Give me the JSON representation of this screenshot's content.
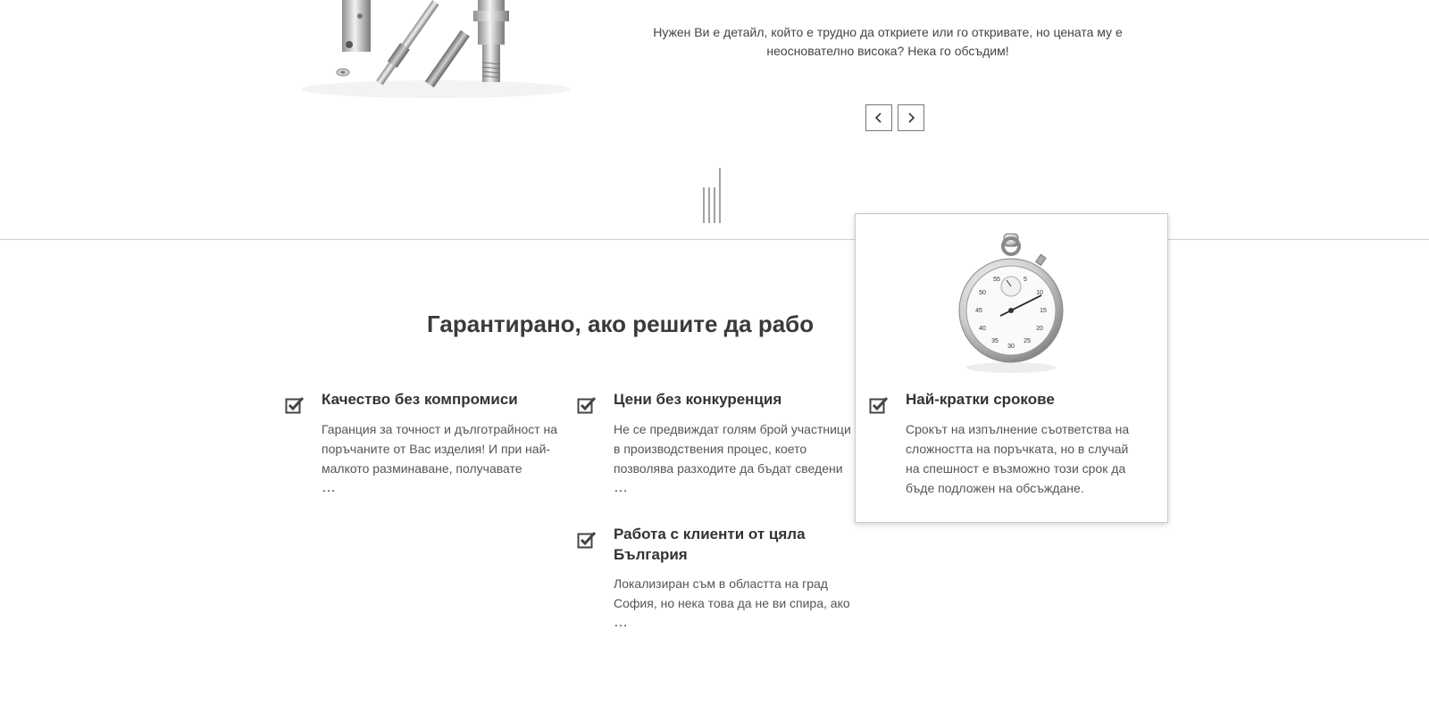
{
  "intro": {
    "text_line1": "Нужен Ви е детайл, който е трудно да откриете или го откривате, но цената му е",
    "text_line2": "неоснователно висока? Нека го обсъдим!"
  },
  "slider": {
    "prev_icon": "chevron-left-icon",
    "next_icon": "chevron-right-icon"
  },
  "section": {
    "title": "Гарантирано, ако решите да рабо"
  },
  "features": [
    {
      "title": "Качество без компромиси",
      "lines": [
        "Гаранция за точност и дълготрайност на",
        "поръчаните от Вас изделия! И при най-",
        "малкото разминаване, получавате"
      ],
      "more": "…"
    },
    {
      "title": "Цени без конкуренция",
      "lines": [
        "Не се предвиждат голям брой участници",
        "в производствения процес, което",
        "позволява разходите да бъдат сведени"
      ],
      "more": "…"
    },
    {
      "title": "Най-кратки срокове",
      "lines": [
        "Срокът на изпълнение съответства на",
        "сложността на поръчката, но в случай",
        "на спешност е възможно този срок да",
        "бъде подложен на обсъждане."
      ]
    },
    {
      "title_line1": "Работа с клиенти от цяла",
      "title_line2": "България",
      "lines": [
        "Локализиран съм в областта на град",
        "София, но нека това да не ви спира, ако"
      ],
      "more": "…"
    }
  ],
  "stopwatch_dial": [
    "55",
    "5",
    "50",
    "10",
    "45",
    "15",
    "40",
    "20",
    "35",
    "25",
    "30"
  ],
  "colors": {
    "text": "#333333",
    "divider": "#cfcfcf",
    "icon": "#444444"
  }
}
